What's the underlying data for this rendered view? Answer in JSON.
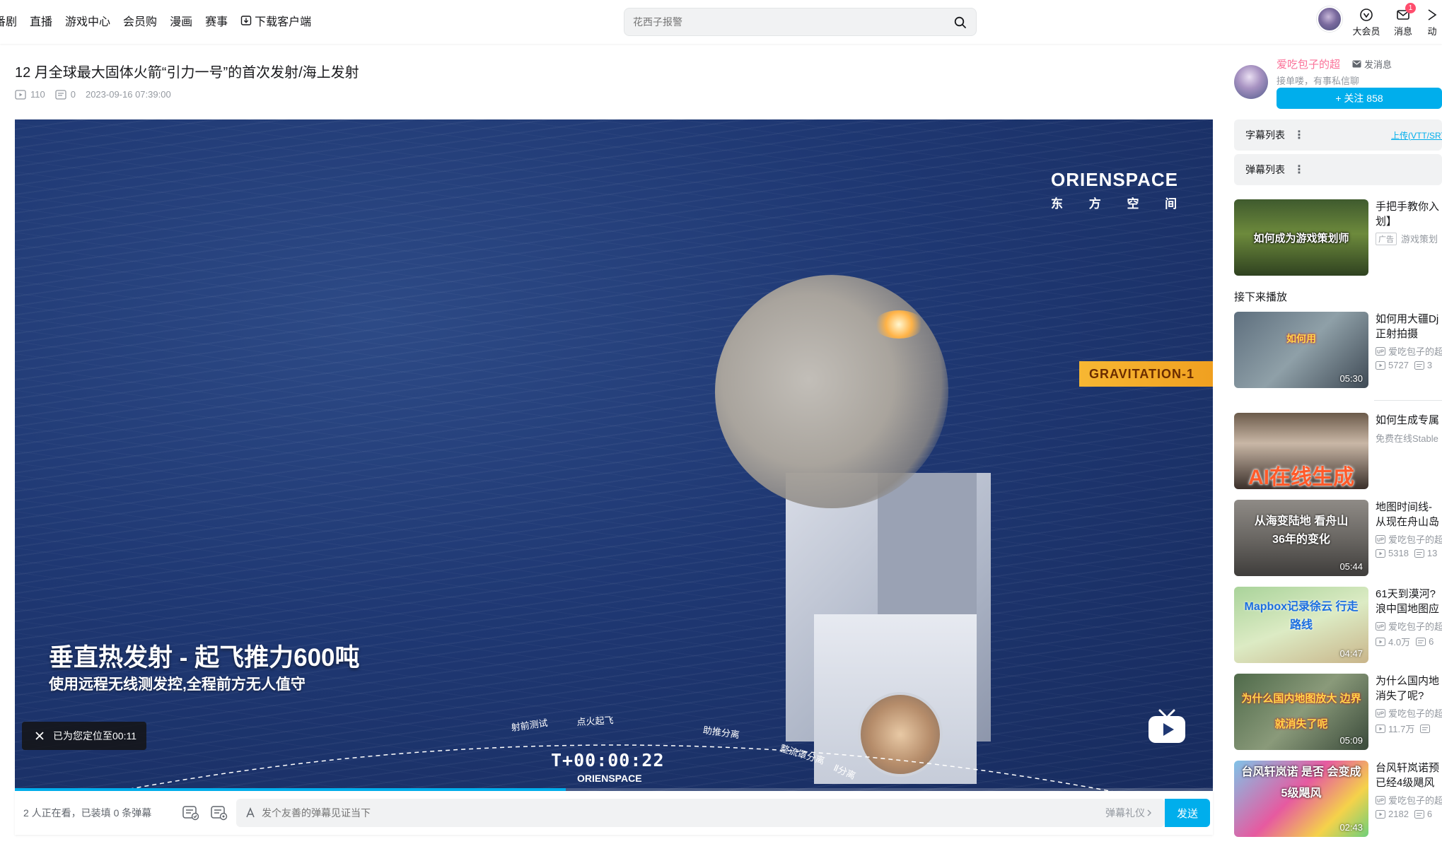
{
  "nav": {
    "items": [
      "番剧",
      "直播",
      "游戏中心",
      "会员购",
      "漫画",
      "赛事",
      "下载客户端"
    ]
  },
  "search": {
    "placeholder": "花西子报警"
  },
  "header_right": {
    "vip_label": "大会员",
    "msg_label": "消息",
    "msg_badge": "1",
    "dyn_label": "动"
  },
  "video": {
    "title": "12 月全球最大固体火箭“引力一号”的首次发射/海上发射",
    "plays": "110",
    "danmaku_count": "0",
    "date": "2023-09-16 07:39:00"
  },
  "player": {
    "logo_en": "ORIENSPACE",
    "logo_cn": "东 方 空 间",
    "tag": "GRAVITATION-1",
    "caption_main": "垂直热发射 - 起飞推力600吨",
    "caption_sub": "使用远程无线测发控,全程前方无人值守",
    "timeline": [
      "射前测试",
      "点火起飞",
      "助推分离",
      "整流罩分离",
      "Ⅱ分离"
    ],
    "countdown": "T+00:00:22",
    "logo_small": "ORIENSPACE",
    "toast": "已为您定位至00:11",
    "progress": 0.46
  },
  "danmaku_bar": {
    "info": "2 人正在看，已装填 0 条弹幕",
    "placeholder": "发个友善的弹幕见证当下",
    "gift": "弹幕礼仪",
    "send": "发送"
  },
  "uploader": {
    "name": "爱吃包子的超",
    "msg": "发消息",
    "desc": "接单喽，有事私信聊",
    "follow": "+ 关注 858"
  },
  "panels": {
    "subtitle_list": "字幕列表",
    "subtitle_upload": "上传(VTT/SRT",
    "danmaku_list": "弹幕列表"
  },
  "ad": {
    "thumb_text": "如何成为游戏策划师",
    "title": "手把手教你入划】",
    "tag": "广告",
    "source": "游戏策划"
  },
  "next_label": "接下来播放",
  "recommend": [
    {
      "thumb_text": "如何用",
      "duration": "05:30",
      "title": "如何用大疆Dj正射拍摄",
      "author": "爱吃包子的超",
      "plays": "5727",
      "comments": "3"
    },
    {
      "thumb_text": "AI在线生成",
      "duration": "",
      "title": "如何生成专属",
      "author": "免费在线Stable",
      "plays": "",
      "comments": ""
    },
    {
      "thumb_text": "从海变陆地 看舟山36年的变化",
      "duration": "05:44",
      "title": "地图时间线-从现在舟山岛周",
      "author": "爱吃包子的超",
      "plays": "5318",
      "comments": "13"
    },
    {
      "thumb_text": "Mapbox记录徐云 行走路线",
      "duration": "04:47",
      "title": "61天到漠河?浪中国地图应",
      "author": "爱吃包子的超",
      "plays": "4.0万",
      "comments": "6"
    },
    {
      "thumb_text": "为什么国内地图放大 边界就消失了呢",
      "duration": "05:09",
      "title": "为什么国内地消失了呢?",
      "author": "爱吃包子的超",
      "plays": "11.7万",
      "comments": ""
    },
    {
      "thumb_text": "台风轩岚诺 是否 会变成5级飓风",
      "duration": "02:43",
      "title": "台风轩岚诺预已经4级飓风",
      "author": "爱吃包子的超",
      "plays": "2182",
      "comments": "6"
    }
  ],
  "colors": {
    "accent": "#00aeec",
    "pink": "#fb7299"
  }
}
